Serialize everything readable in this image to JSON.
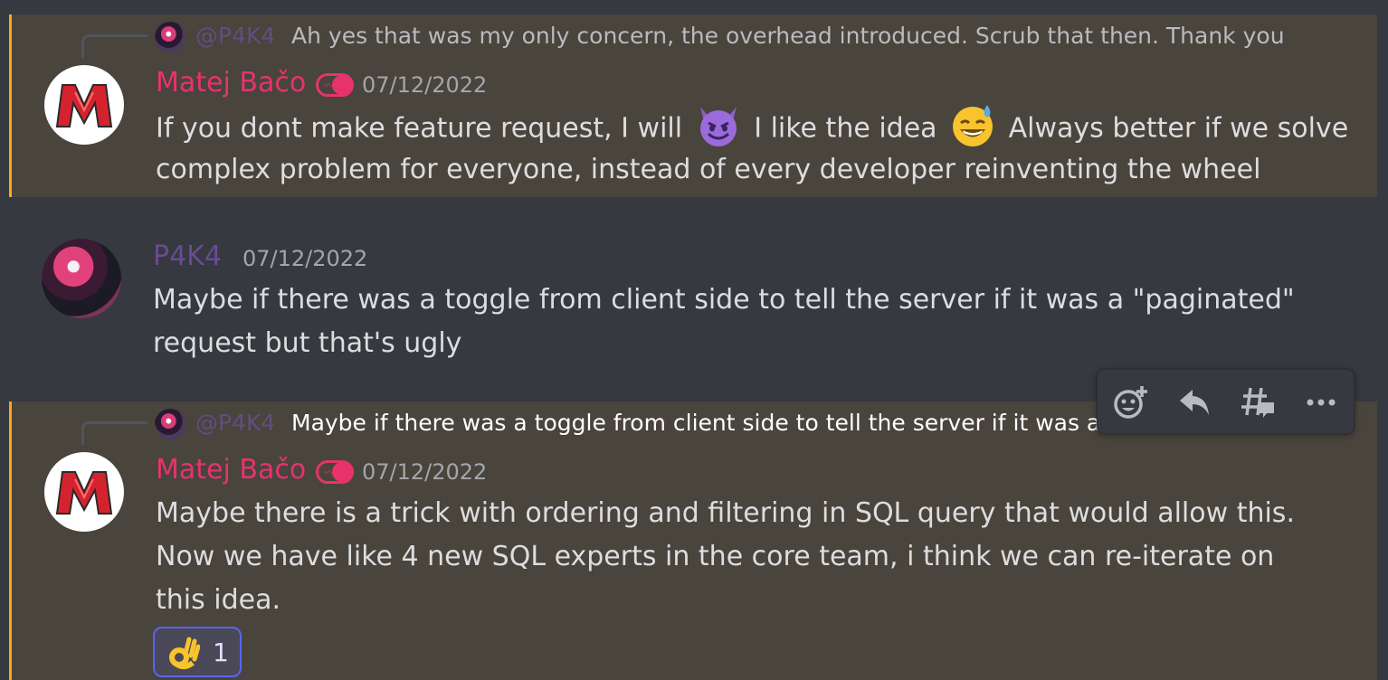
{
  "messages": [
    {
      "reply": {
        "author": "@P4K4",
        "text": "Ah yes that was my only concern, the overhead introduced. Scrub that then. Thank you"
      },
      "author": "Matej Bačo",
      "timestamp": "07/12/2022",
      "line1_part1": "If you dont make feature request, I will",
      "line1_part2": "I like the idea",
      "line1_part3": "Always better if we solve",
      "line2": "complex problem for everyone, instead of every developer reinventing the wheel"
    },
    {
      "author": "P4K4",
      "timestamp": "07/12/2022",
      "line1": "Maybe if there was a toggle from client side to tell the server if it was a \"paginated\"",
      "line2": "request but that's ugly"
    },
    {
      "reply": {
        "author": "@P4K4",
        "text": "Maybe if there was a toggle from client side to tell the server if it was a"
      },
      "author": "Matej Bačo",
      "timestamp": "07/12/2022",
      "line1": "Maybe there is a trick with ordering and filtering in SQL query that would allow this.",
      "line2": "Now we have like 4 new SQL experts in the core team, i think we can re-iterate on",
      "line3": "this idea.",
      "reaction": {
        "emoji": "ok-hand",
        "count": "1"
      }
    }
  ],
  "colors": {
    "background": "#36393f",
    "mention_bg": "#49443c",
    "mention_bar": "#faa81a",
    "matej_name": "#e7336b",
    "p4k4_name": "#6a4a93",
    "reaction_border": "#5865f2"
  },
  "toolbar_icons": [
    "add-reaction-icon",
    "reply-icon",
    "create-thread-icon",
    "more-icon"
  ]
}
